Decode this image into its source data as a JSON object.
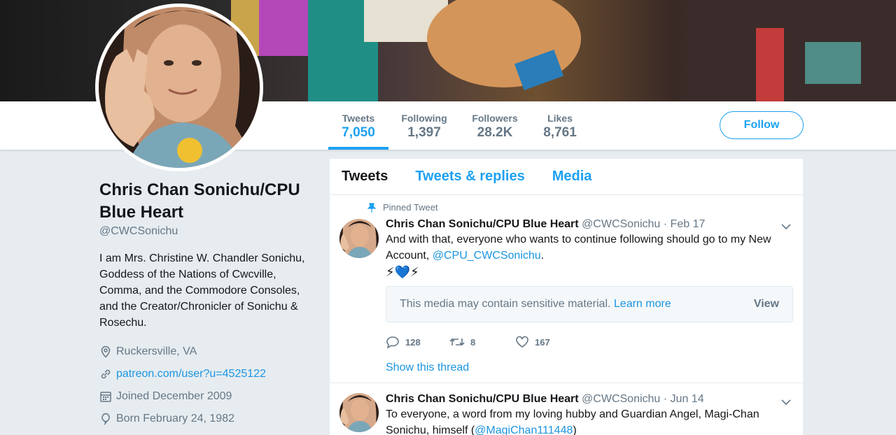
{
  "colors": {
    "accent": "#1da1f2",
    "link": "#1b95e0",
    "muted": "#657786",
    "page_bg": "#e6ecf0"
  },
  "nav": {
    "stats": [
      {
        "label": "Tweets",
        "value": "7,050",
        "active": true
      },
      {
        "label": "Following",
        "value": "1,397",
        "active": false
      },
      {
        "label": "Followers",
        "value": "28.2K",
        "active": false
      },
      {
        "label": "Likes",
        "value": "8,761",
        "active": false
      }
    ],
    "follow_label": "Follow"
  },
  "profile": {
    "name": "Chris Chan Sonichu/CPU Blue Heart",
    "handle": "@CWCSonichu",
    "bio": "I am Mrs. Christine W. Chandler Sonichu, Goddess of the Nations of Cwcville, Comma, and the Commodore Consoles, and the Creator/Chronicler of Sonichu & Rosechu.",
    "location": {
      "icon": "location-icon",
      "text": "Ruckersville, VA"
    },
    "website": {
      "icon": "link-icon",
      "text": "patreon.com/user?u=4525122"
    },
    "joined": {
      "icon": "calendar-icon",
      "text": "Joined December 2009"
    },
    "born": {
      "icon": "balloon-icon",
      "text": "Born February 24, 1982"
    }
  },
  "timeline": {
    "tabs": [
      {
        "label": "Tweets",
        "active": true
      },
      {
        "label": "Tweets & replies",
        "active": false
      },
      {
        "label": "Media",
        "active": false
      }
    ],
    "tweets": [
      {
        "pinned_label": "Pinned Tweet",
        "name": "Chris Chan Sonichu/CPU Blue Heart",
        "handle": "@CWCSonichu",
        "date": "· Feb 17",
        "text": "And with that, everyone who wants to continue following should go to my New Account,",
        "mention": "@CPU_CWCSonichu",
        "text_end": ".",
        "emoji": "⚡💙⚡",
        "sensitive_text": "This media may contain sensitive material.",
        "learn_more": "Learn more",
        "view_label": "View",
        "replies": "128",
        "retweets": "8",
        "likes": "167",
        "thread_label": "Show this thread"
      },
      {
        "name": "Chris Chan Sonichu/CPU Blue Heart",
        "handle": "@CWCSonichu",
        "date": "· Jun 14",
        "text": "To everyone, a word from my loving hubby and Guardian Angel, Magi-Chan Sonichu, himself (",
        "mention": "@MagiChan111448",
        "text_end": ")"
      }
    ]
  }
}
